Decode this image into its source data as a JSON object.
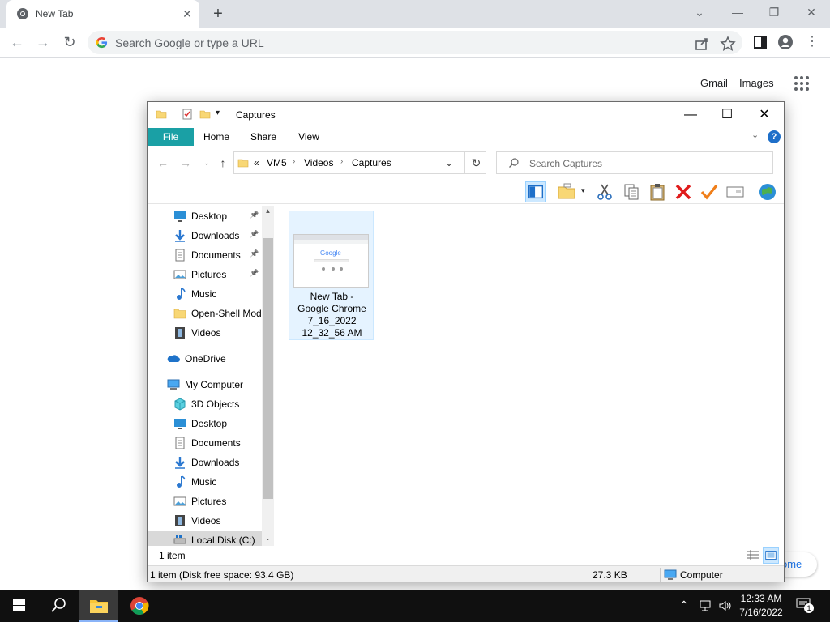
{
  "chrome": {
    "tab_title": "New Tab",
    "new_tab_symbol": "+",
    "omnibox_placeholder": "Search Google or type a URL",
    "gmail": "Gmail",
    "images": "Images",
    "customize_partial": "ome"
  },
  "explorer": {
    "title": "Captures",
    "ribbon_tabs": [
      "File",
      "Home",
      "Share",
      "View"
    ],
    "address": {
      "overflow": "«",
      "crumbs": [
        "VM5",
        "Videos",
        "Captures"
      ]
    },
    "search_placeholder": "Search Captures",
    "nav_items": [
      {
        "label": "Desktop",
        "icon": "desktop-icon",
        "pinned": true
      },
      {
        "label": "Downloads",
        "icon": "downloads-icon",
        "pinned": true
      },
      {
        "label": "Documents",
        "icon": "documents-icon",
        "pinned": true
      },
      {
        "label": "Pictures",
        "icon": "pictures-icon",
        "pinned": true
      },
      {
        "label": "Music",
        "icon": "music-icon",
        "pinned": false
      },
      {
        "label": "Open-Shell Mod",
        "icon": "folder-icon",
        "pinned": false
      },
      {
        "label": "Videos",
        "icon": "videos-icon",
        "pinned": false
      },
      {
        "label": "OneDrive",
        "icon": "onedrive-icon",
        "pinned": false
      },
      {
        "label": "My Computer",
        "icon": "computer-icon",
        "pinned": false
      },
      {
        "label": "3D Objects",
        "icon": "3d-objects-icon",
        "pinned": false
      },
      {
        "label": "Desktop",
        "icon": "desktop-icon",
        "pinned": false
      },
      {
        "label": "Documents",
        "icon": "documents-icon",
        "pinned": false
      },
      {
        "label": "Downloads",
        "icon": "downloads-icon",
        "pinned": false
      },
      {
        "label": "Music",
        "icon": "music-icon",
        "pinned": false
      },
      {
        "label": "Pictures",
        "icon": "pictures-icon",
        "pinned": false
      },
      {
        "label": "Videos",
        "icon": "videos-icon",
        "pinned": false
      },
      {
        "label": "Local Disk (C:)",
        "icon": "local-disk-icon",
        "pinned": false
      }
    ],
    "file": {
      "name_lines": [
        "New Tab -",
        "Google Chrome",
        "7_16_2022",
        "12_32_56 AM"
      ],
      "thumb_logo": "Google"
    },
    "item_count": "1 item",
    "status": {
      "left": "1 item (Disk free space: 93.4 GB)",
      "size": "27.3 KB",
      "location": "Computer"
    }
  },
  "taskbar": {
    "time": "12:33 AM",
    "date": "7/16/2022",
    "notification_count": "1"
  },
  "colors": {
    "file_tab": "#1aa0a5",
    "selection": "#cce8ff",
    "taskbar": "#101010"
  }
}
